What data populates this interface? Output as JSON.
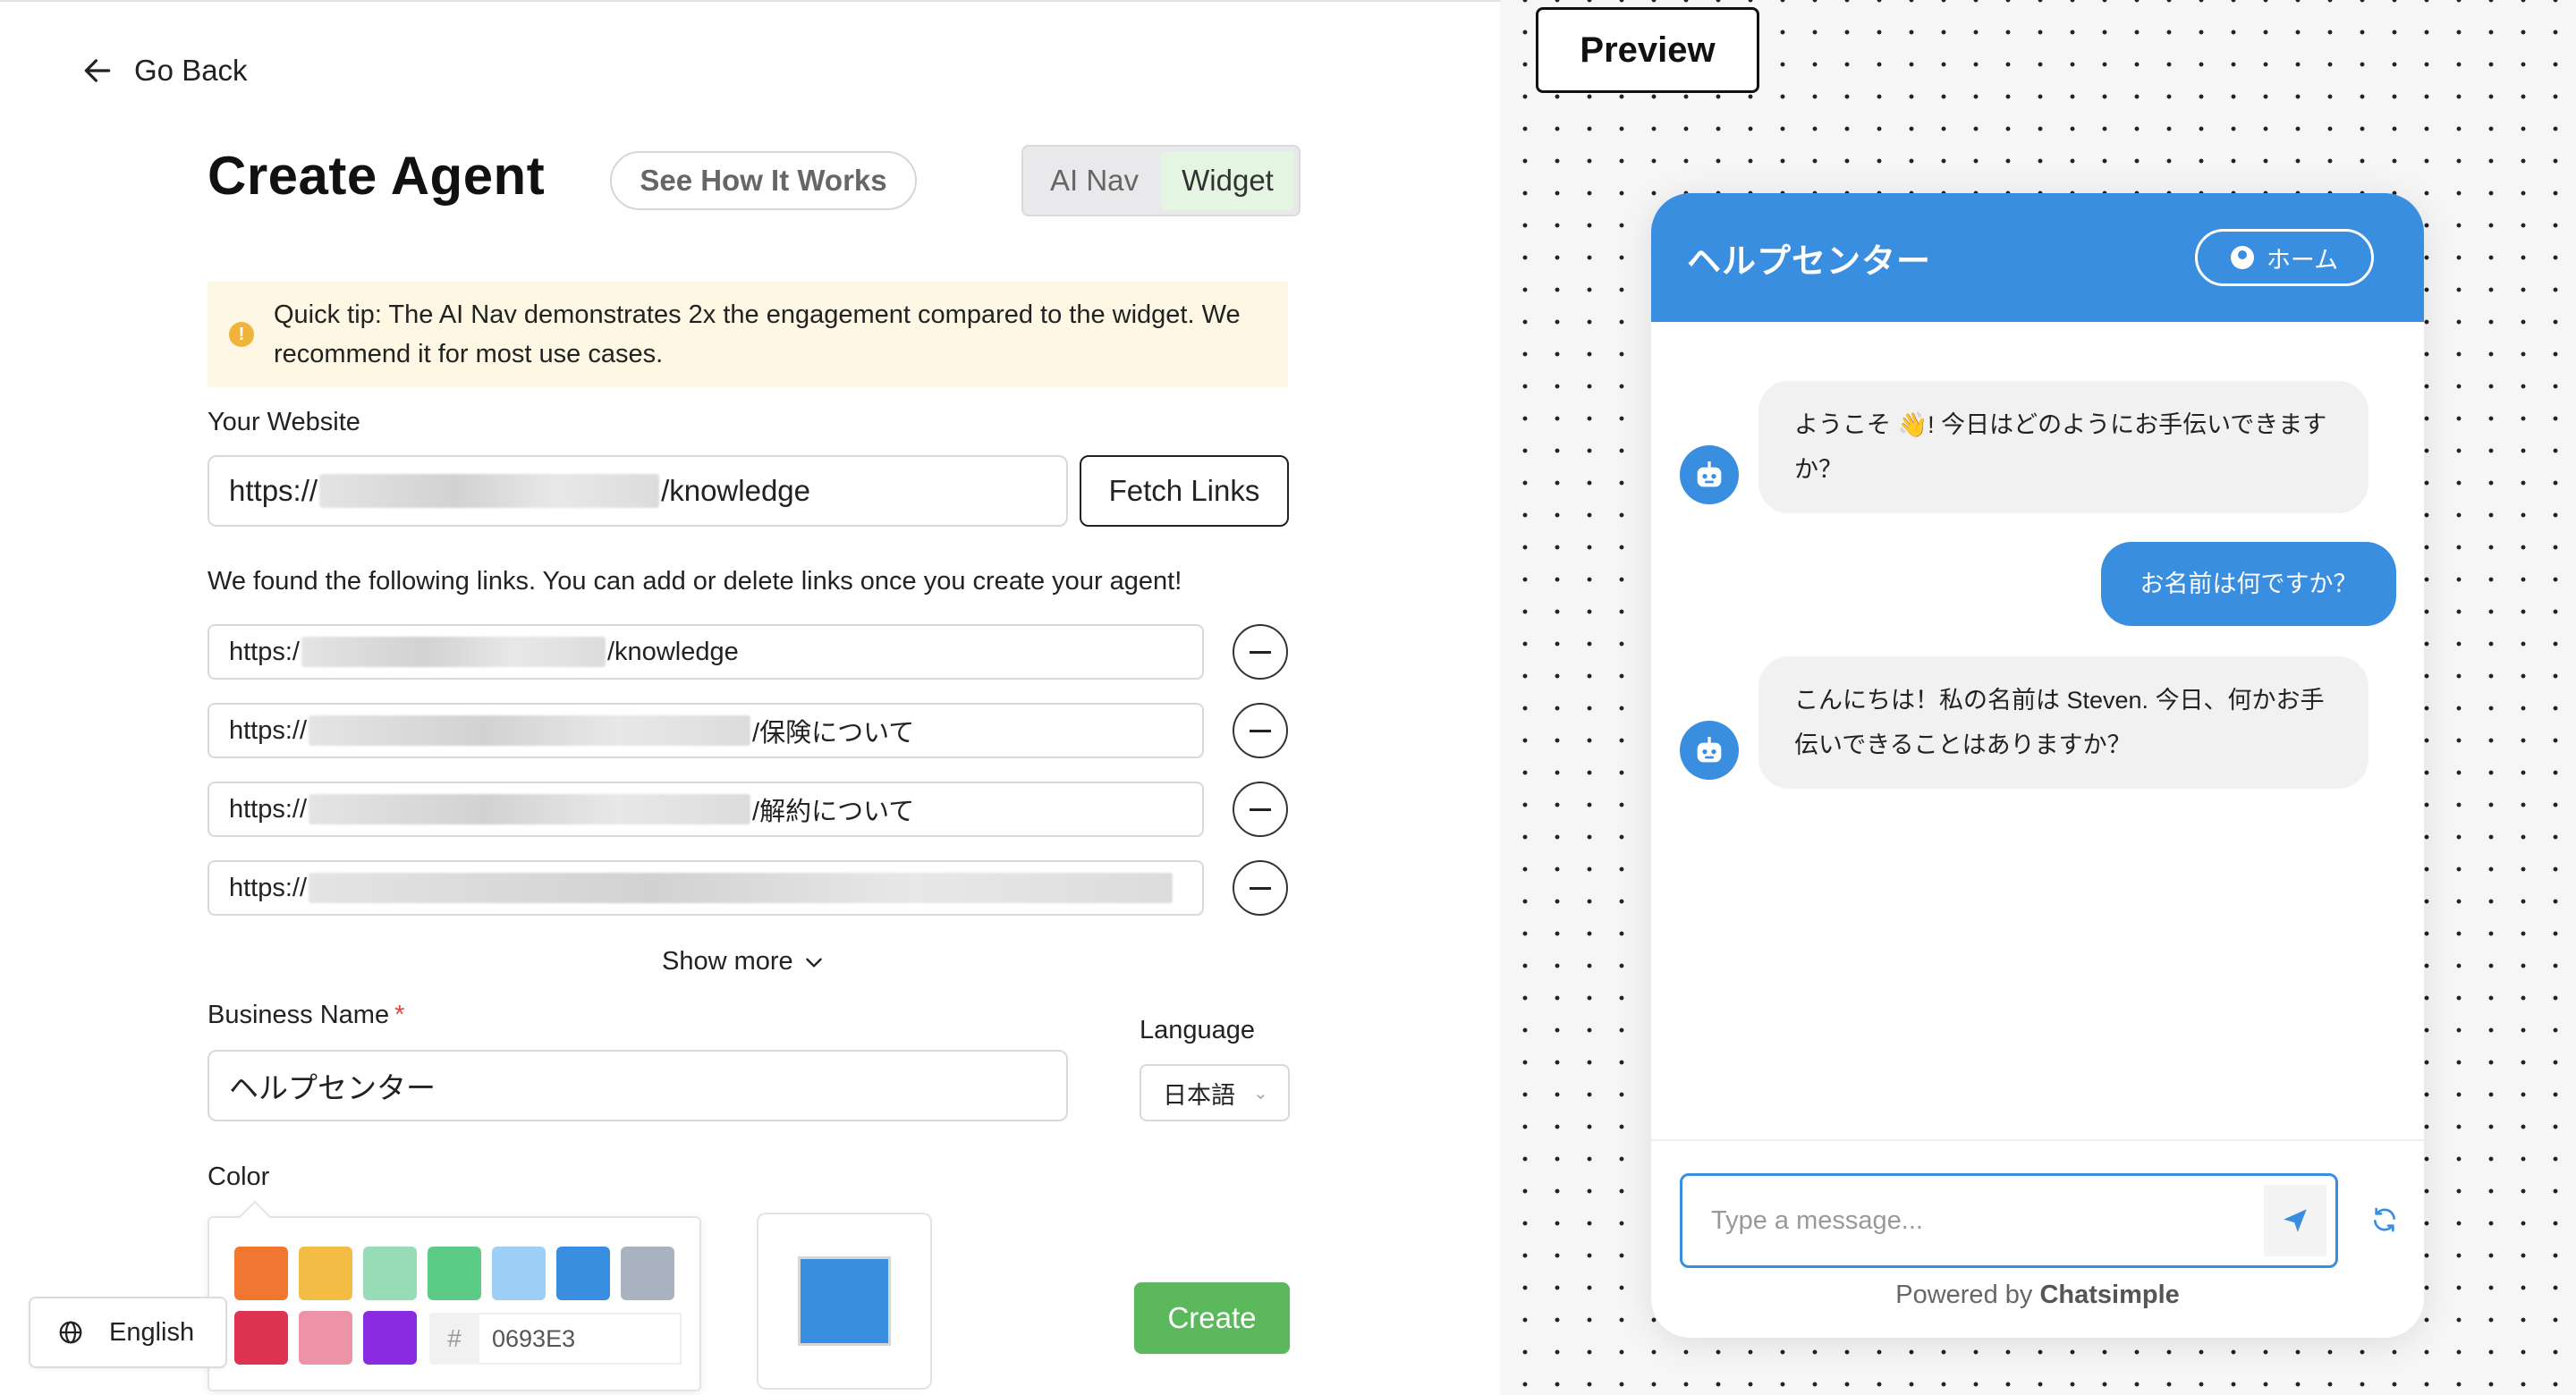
{
  "nav": {
    "back_label": "Go Back"
  },
  "header": {
    "title": "Create Agent",
    "see_how_label": "See How It Works",
    "modes": [
      {
        "label": "AI Nav",
        "active": false
      },
      {
        "label": "Widget",
        "active": true
      }
    ]
  },
  "tip": {
    "text": "Quick tip: The AI Nav demonstrates 2x the engagement compared to the widget. We recommend it for most use cases."
  },
  "website": {
    "label": "Your Website",
    "prefix": "https://",
    "suffix": "/knowledge",
    "fetch_label": "Fetch Links"
  },
  "links": {
    "intro": "We found the following links. You can add or delete links once you create your agent!",
    "items": [
      {
        "prefix": "https:/",
        "suffix": "/knowledge"
      },
      {
        "prefix": "https://",
        "suffix": "/保険について"
      },
      {
        "prefix": "https://",
        "suffix": "/解約について"
      },
      {
        "prefix": "https://",
        "suffix": ""
      }
    ],
    "show_more_label": "Show more"
  },
  "business": {
    "label": "Business Name",
    "required_mark": "*",
    "value": "ヘルプセンター"
  },
  "language": {
    "label": "Language",
    "value": "日本語"
  },
  "color": {
    "label": "Color",
    "swatches": [
      "#ef7732",
      "#f3bc45",
      "#97dbb7",
      "#5ccb86",
      "#9ecff7",
      "#3a8ee0",
      "#a9b3bf",
      "#de3452",
      "#ec93a5",
      "#8a2be2"
    ],
    "hash": "#",
    "hex_value": "0693E3",
    "preview_color": "#3a8ee0"
  },
  "create_label": "Create",
  "ui_language": {
    "label": "English"
  },
  "preview": {
    "label": "Preview",
    "widget_title": "ヘルプセンター",
    "home_label": "ホーム",
    "messages": [
      {
        "role": "bot",
        "text": "ようこそ 👋! 今日はどのようにお手伝いできますか？"
      },
      {
        "role": "user",
        "text": "お名前は何ですか？"
      },
      {
        "role": "bot",
        "text": "こんにちは！私の名前は Steven. 今日、何かお手伝いできることはありますか？"
      }
    ],
    "input_placeholder": "Type a message...",
    "powered_prefix": "Powered by ",
    "powered_brand": "Chatsimple",
    "accent": "#3a8ee0"
  }
}
